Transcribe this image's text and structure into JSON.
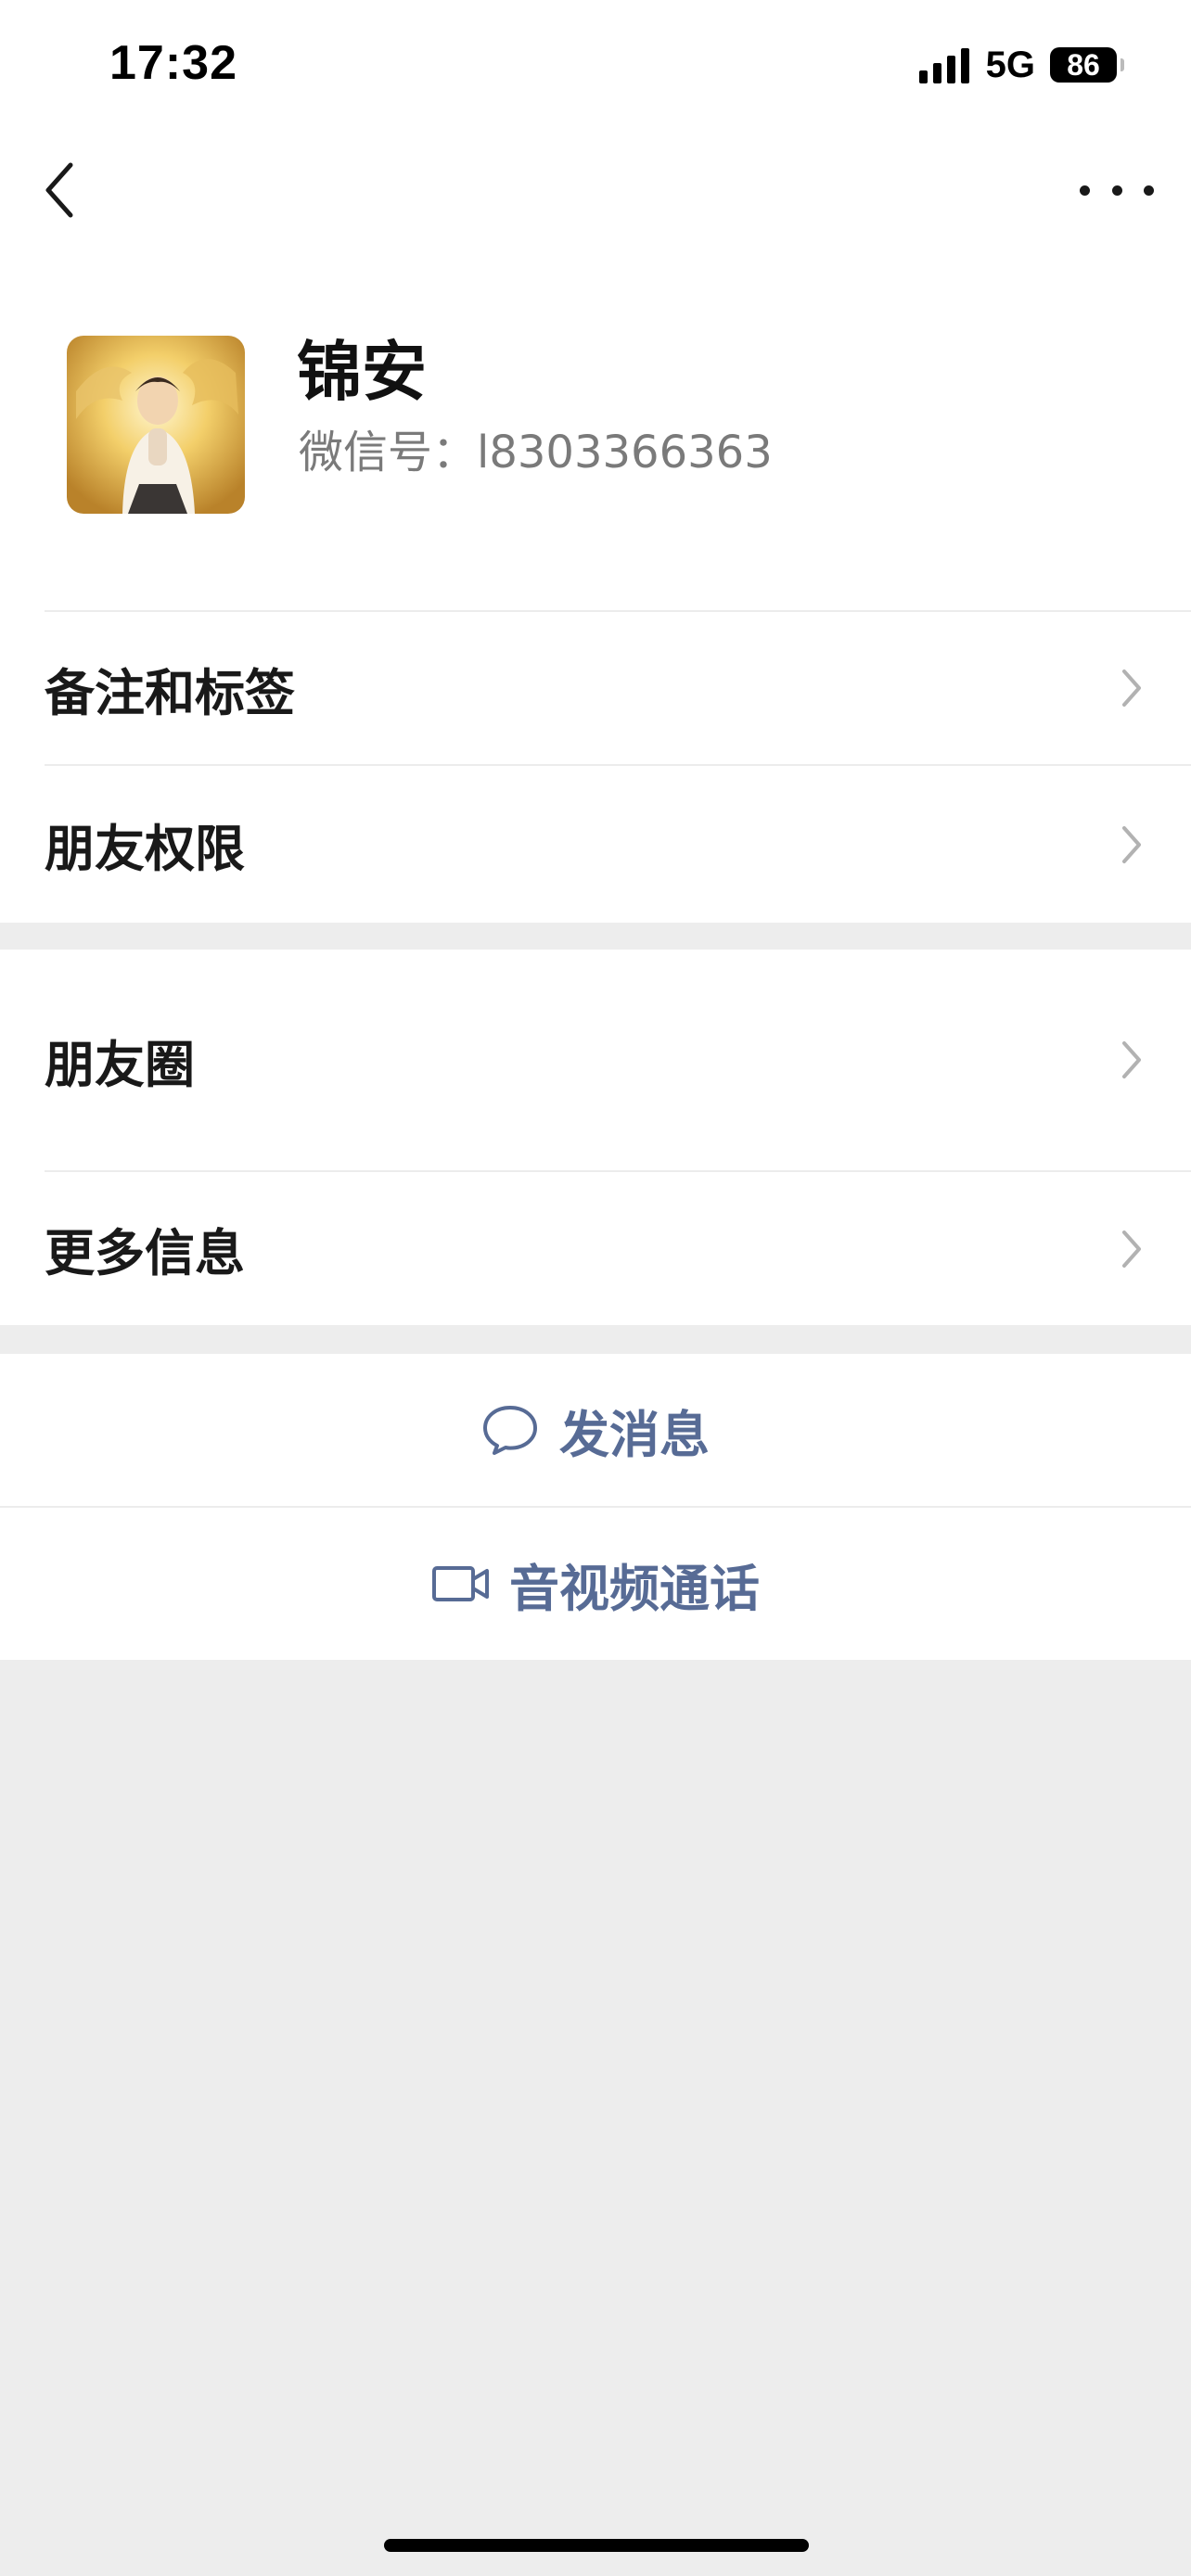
{
  "status_bar": {
    "time": "17:32",
    "network": "5G",
    "battery": "86"
  },
  "nav": {
    "back_icon": "chevron-left-icon",
    "more_icon": "more-dots-icon"
  },
  "profile": {
    "name": "锦安",
    "wechat_id": "微信号：l8303366363",
    "avatar_icon": "avatar-image"
  },
  "menu": {
    "remark_tags": "备注和标签",
    "permissions": "朋友权限",
    "moments": "朋友圈",
    "more_info": "更多信息"
  },
  "actions": {
    "send_message": "发消息",
    "send_message_icon": "chat-bubble-icon",
    "video_call": "音视频通话",
    "video_call_icon": "video-camera-icon"
  },
  "colors": {
    "link_blue": "#576b95",
    "background": "#ededed",
    "card": "#ffffff"
  }
}
